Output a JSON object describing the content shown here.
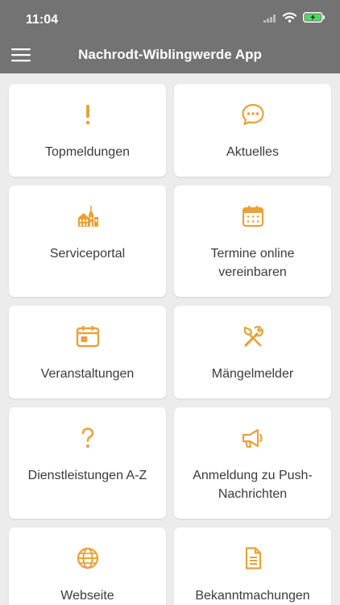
{
  "status": {
    "time": "11:04"
  },
  "header": {
    "title": "Nachrodt-Wiblingwerde App"
  },
  "colors": {
    "accent": "#e8a23a",
    "header_bg": "#737373",
    "background": "#ececec"
  },
  "tiles": [
    {
      "label": "Topmeldungen",
      "icon": "exclamation-icon"
    },
    {
      "label": "Aktuelles",
      "icon": "chat-bubble-icon"
    },
    {
      "label": "Serviceportal",
      "icon": "town-hall-icon"
    },
    {
      "label": "Termine online vereinbaren",
      "icon": "calendar-grid-icon"
    },
    {
      "label": "Veranstaltungen",
      "icon": "calendar-event-icon"
    },
    {
      "label": "Mängelmelder",
      "icon": "tools-icon"
    },
    {
      "label": "Dienstleistungen A-Z",
      "icon": "question-mark-icon"
    },
    {
      "label": "Anmeldung zu Push-Nachrichten",
      "icon": "megaphone-icon"
    },
    {
      "label": "Webseite",
      "icon": "globe-icon"
    },
    {
      "label": "Bekanntmachungen",
      "icon": "document-icon"
    }
  ]
}
